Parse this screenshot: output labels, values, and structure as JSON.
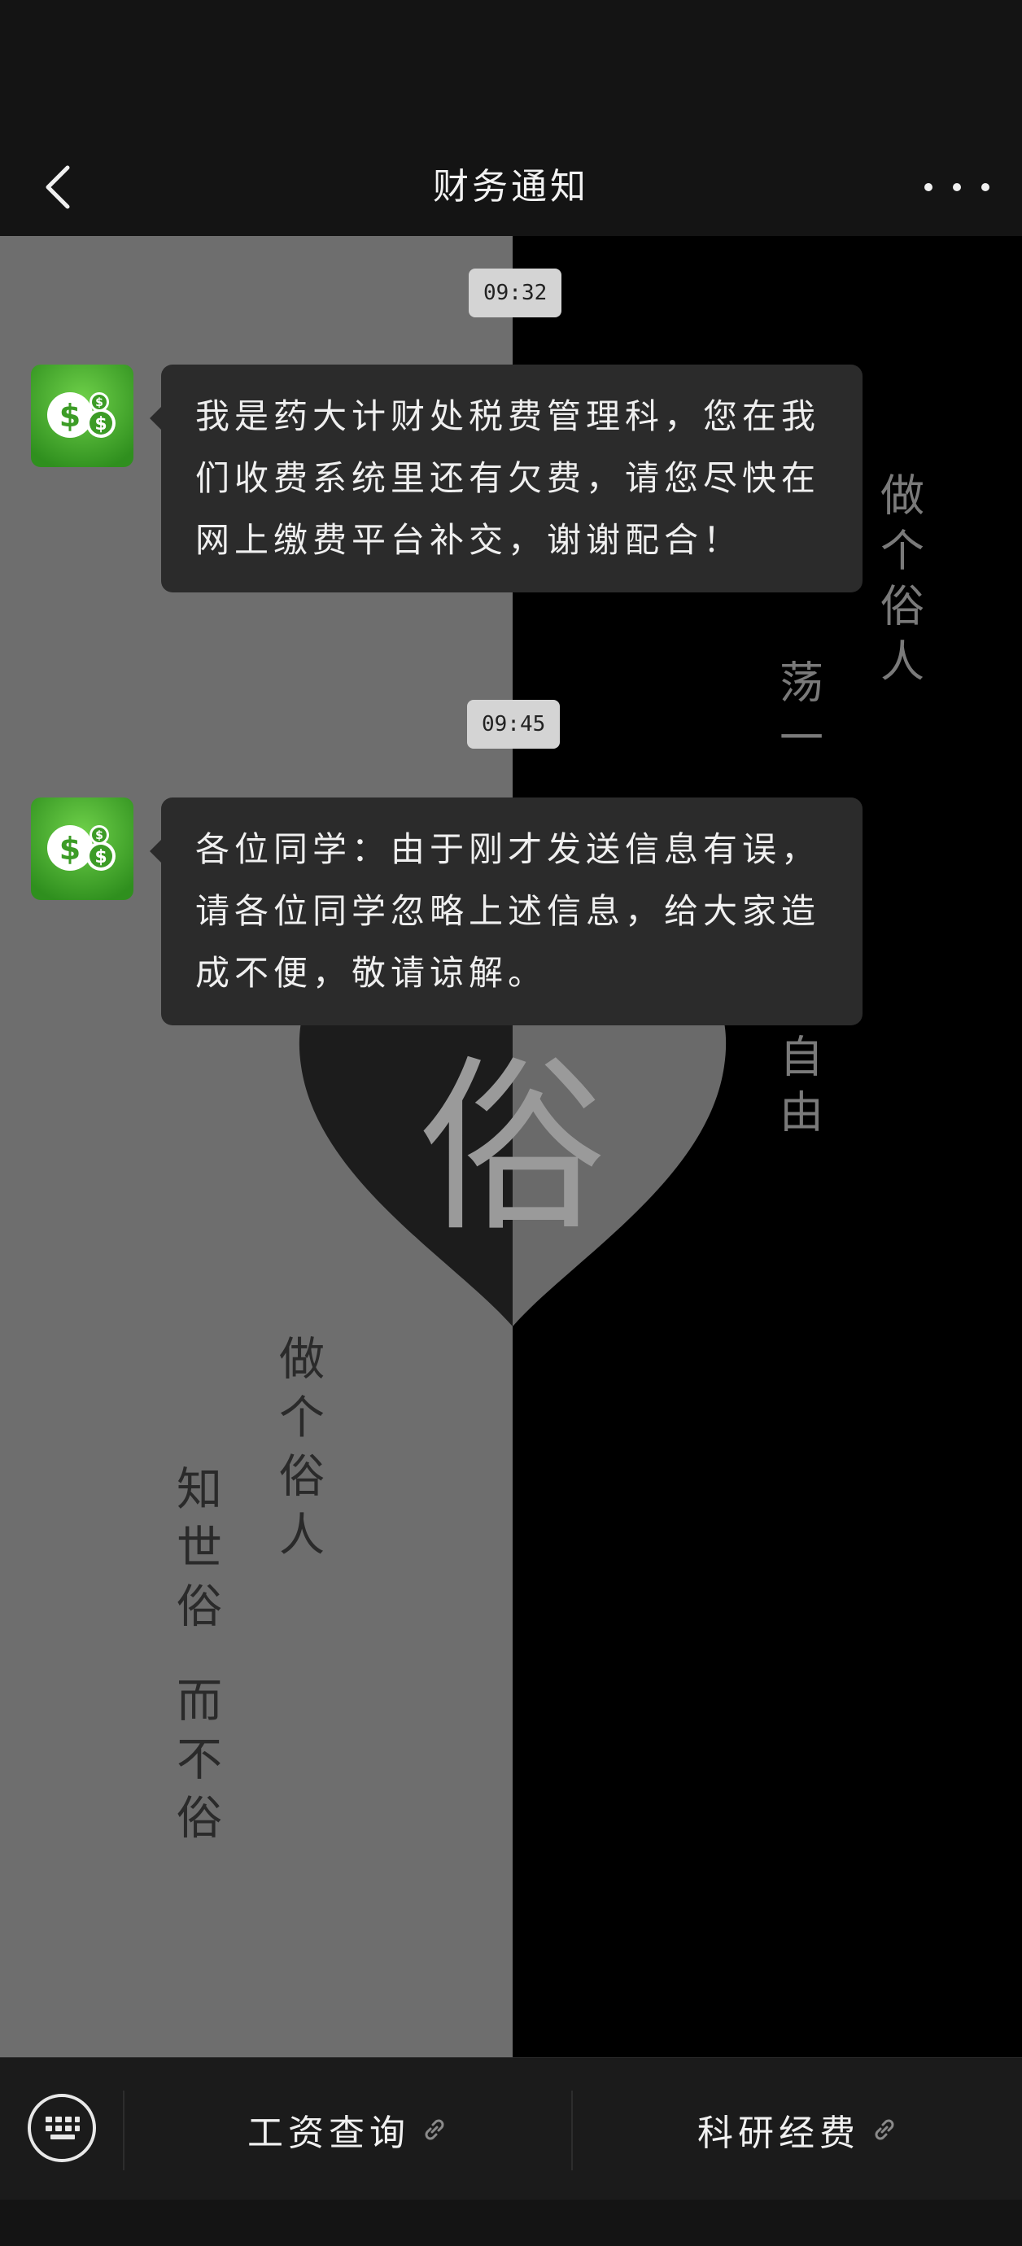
{
  "nav": {
    "title": "财务通知",
    "back_icon": "chevron-left-icon",
    "more_icon": "more-horizontal-icon"
  },
  "messages": [
    {
      "time": "09:32",
      "sender_avatar": "money-coins-icon",
      "text": "我是药大计财处税费管理科，您在我们收费系统里还有欠费，请您尽快在网上缴费平台补交，谢谢配合！"
    },
    {
      "time": "09:45",
      "sender_avatar": "money-coins-icon",
      "text": "各位同学：由于刚才发送信息有误，请各位同学忽略上述信息，给大家造成不便，敬请谅解。"
    }
  ],
  "wallpaper": {
    "center_glyph": "俗",
    "right_column_1": "做个俗人",
    "right_column_2": "荡一",
    "right_column_3": "自由",
    "left_column_1": "做个俗人",
    "left_column_2": "知世俗",
    "left_column_3": "而不俗"
  },
  "bottom_menu": {
    "keyboard_icon": "keyboard-icon",
    "items": [
      {
        "label": "工资查询",
        "icon": "link-icon"
      },
      {
        "label": "科研经费",
        "icon": "link-icon"
      }
    ]
  },
  "colors": {
    "background": "#141414",
    "bubble": "#2b2b2b",
    "avatar_green": "#3fa52a",
    "time_chip": "#d4d4d4",
    "wallpaper_left": "#6e6e6e",
    "wallpaper_right": "#000000"
  }
}
